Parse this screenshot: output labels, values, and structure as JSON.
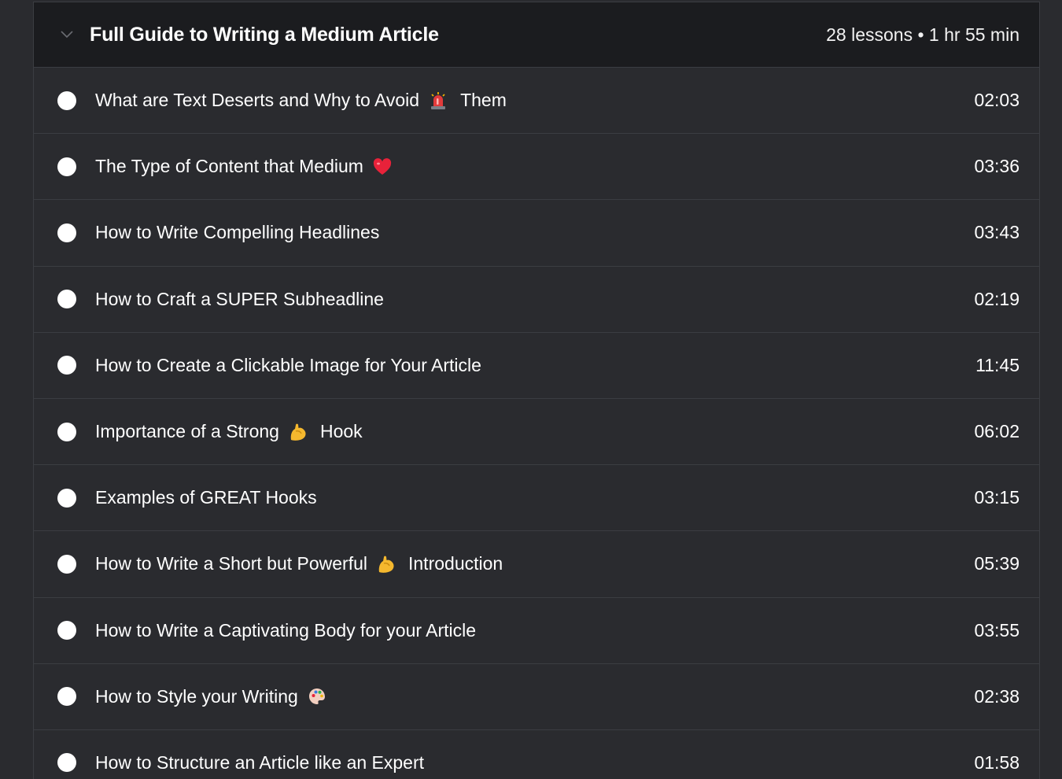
{
  "module": {
    "title": "Full Guide to Writing a Medium Article",
    "meta": "28 lessons • 1 hr 55 min",
    "lessons": [
      {
        "pre": "What are Text Deserts and Why to Avoid",
        "icon": "siren-icon",
        "post": "Them",
        "duration": "02:03"
      },
      {
        "pre": "The Type of Content that Medium",
        "icon": "heart-icon",
        "post": "",
        "duration": "03:36"
      },
      {
        "pre": "How to Write Compelling Headlines",
        "icon": "",
        "post": "",
        "duration": "03:43"
      },
      {
        "pre": "How to Craft a SUPER Subheadline",
        "icon": "",
        "post": "",
        "duration": "02:19"
      },
      {
        "pre": "How to Create a Clickable Image for Your Article",
        "icon": "",
        "post": "",
        "duration": "11:45"
      },
      {
        "pre": "Importance of a Strong",
        "icon": "flexed-biceps-icon",
        "post": "Hook",
        "duration": "06:02"
      },
      {
        "pre": "Examples of GREAT Hooks",
        "icon": "",
        "post": "",
        "duration": "03:15"
      },
      {
        "pre": "How to Write a Short but Powerful",
        "icon": "flexed-biceps-icon",
        "post": "Introduction",
        "duration": "05:39"
      },
      {
        "pre": "How to Write a Captivating Body for your Article",
        "icon": "",
        "post": "",
        "duration": "03:55"
      },
      {
        "pre": "How to Style your Writing",
        "icon": "palette-icon",
        "post": "",
        "duration": "02:38"
      },
      {
        "pre": "How to Structure an Article like an Expert",
        "icon": "",
        "post": "",
        "duration": "01:58"
      }
    ]
  },
  "colors": {
    "background": "#2a2b2f",
    "header": "#1b1c1f",
    "border": "#3b3d42",
    "text": "#ffffff"
  }
}
